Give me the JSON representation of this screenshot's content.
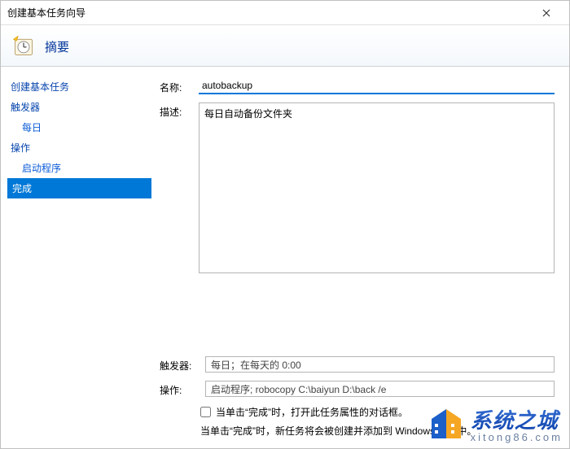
{
  "window": {
    "title": "创建基本任务向导"
  },
  "header": {
    "title": "摘要"
  },
  "sidebar": {
    "items": [
      {
        "label": "创建基本任务",
        "sub": false,
        "selected": false
      },
      {
        "label": "触发器",
        "sub": false,
        "selected": false
      },
      {
        "label": "每日",
        "sub": true,
        "selected": false
      },
      {
        "label": "操作",
        "sub": false,
        "selected": false
      },
      {
        "label": "启动程序",
        "sub": true,
        "selected": false
      },
      {
        "label": "完成",
        "sub": false,
        "selected": true
      }
    ]
  },
  "form": {
    "name_label": "名称:",
    "name_value": "autobackup",
    "desc_label": "描述:",
    "desc_value": "每日自动备份文件夹",
    "trigger_label": "触发器:",
    "trigger_value": "每日；在每天的 0:00",
    "action_label": "操作:",
    "action_value": "启动程序; robocopy C:\\baiyun D:\\back /e",
    "open_props_label": "当单击“完成”时，打开此任务属性的对话框。",
    "hint": "当单击“完成”时，新任务将会被创建并添加到 Windows 计划中。"
  },
  "watermark": {
    "cn": "系统之城",
    "url": "xitong86.com"
  }
}
